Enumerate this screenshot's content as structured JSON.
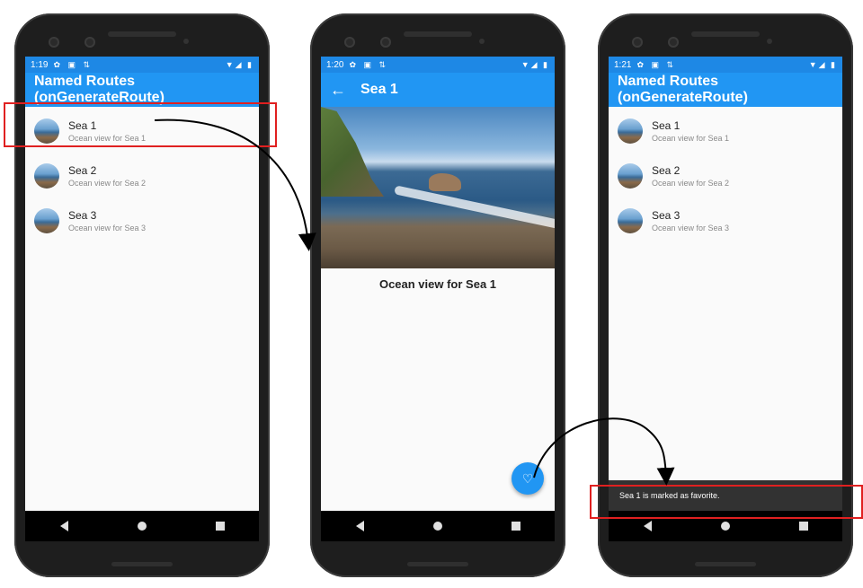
{
  "phone1": {
    "status_time": "1:19",
    "status_icons": "✿ ▣ ⇅",
    "status_right": "▼◢ ▮",
    "app_title": "Named Routes (onGenerateRoute)",
    "items": [
      {
        "title": "Sea 1",
        "subtitle": "Ocean view for Sea 1"
      },
      {
        "title": "Sea 2",
        "subtitle": "Ocean view for Sea 2"
      },
      {
        "title": "Sea 3",
        "subtitle": "Ocean view for Sea 3"
      }
    ]
  },
  "phone2": {
    "status_time": "1:20",
    "status_icons": "✿ ▣ ⇅",
    "status_right": "▼◢ ▮",
    "back_glyph": "←",
    "app_title": "Sea 1",
    "caption": "Ocean view for Sea 1",
    "fab_icon": "heart-outline-icon",
    "fab_glyph": "♡"
  },
  "phone3": {
    "status_time": "1:21",
    "status_icons": "✿ ▣ ⇅",
    "status_right": "▼◢ ▮",
    "app_title": "Named Routes (onGenerateRoute)",
    "items": [
      {
        "title": "Sea 1",
        "subtitle": "Ocean view for Sea 1"
      },
      {
        "title": "Sea 2",
        "subtitle": "Ocean view for Sea 2"
      },
      {
        "title": "Sea 3",
        "subtitle": "Ocean view for Sea 3"
      }
    ],
    "snackbar": "Sea 1 is marked as favorite."
  },
  "colors": {
    "appbar": "#2196f3",
    "statusbar": "#1e88e5",
    "highlight": "#e02020"
  }
}
